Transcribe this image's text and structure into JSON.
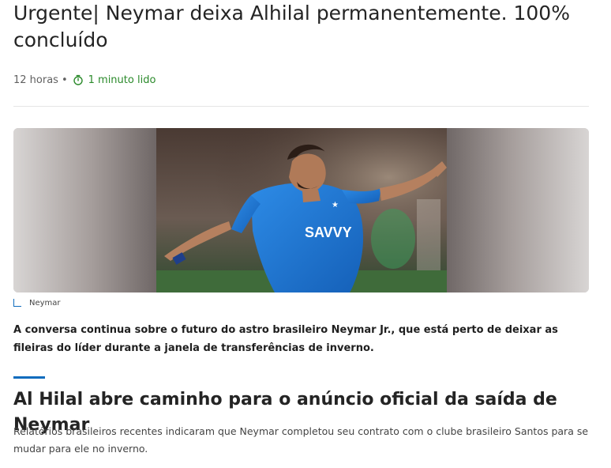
{
  "article": {
    "headline": "Urgente| Neymar deixa Alhilal permanentemente. 100% concluído",
    "meta": {
      "time_ago": "12 horas",
      "separator": "•",
      "read_time": "1 minuto lido",
      "read_time_icon": "timer-icon"
    },
    "image": {
      "alt": "Neymar comemorando com a camisa azul do Al Hilal",
      "caption": "Neymar",
      "caption_icon": "image-corner-icon"
    },
    "lead": "A conversa continua sobre o futuro do astro brasileiro Neymar Jr., que está perto de deixar as fileiras do líder durante a janela de transferências de inverno.",
    "section": {
      "title": "Al Hilal abre caminho para o anúncio oficial da saída de Neymar",
      "body": "Relatórios brasileiros recentes indicaram que Neymar completou seu contrato com o clube brasileiro Santos para se mudar para ele no inverno."
    },
    "colors": {
      "accent": "#0f6cbd",
      "read_time": "#2b8a2b",
      "jersey": "#1f77d6"
    }
  }
}
